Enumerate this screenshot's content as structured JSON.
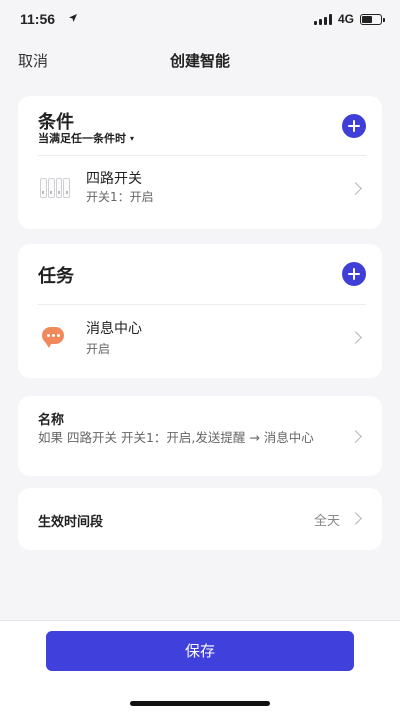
{
  "status_bar": {
    "time": "11:56",
    "network": "4G",
    "location_icon": "location-arrow-icon",
    "battery_level": 0.6
  },
  "nav": {
    "cancel_label": "取消",
    "title": "创建智能"
  },
  "conditions": {
    "title": "条件",
    "mode_label": "当满足任一条件时",
    "mode_icon": "caret-down-icon",
    "add_icon": "plus-circle-icon",
    "items": [
      {
        "title": "四路开关",
        "subtitle": "开关1：开启",
        "icon": "four-gang-switch-icon"
      }
    ]
  },
  "tasks": {
    "title": "任务",
    "add_icon": "plus-circle-icon",
    "items": [
      {
        "title": "消息中心",
        "subtitle": "开启",
        "icon": "message-bubble-icon"
      }
    ]
  },
  "name_section": {
    "label": "名称",
    "value": "如果 四路开关 开关1：开启,发送提醒 → 消息中心"
  },
  "schedule_section": {
    "label": "生效时间段",
    "value": "全天"
  },
  "footer": {
    "save_label": "保存"
  },
  "colors": {
    "accent": "#4040dd",
    "message_icon": "#f08a5d",
    "background": "#f5f5f7"
  }
}
